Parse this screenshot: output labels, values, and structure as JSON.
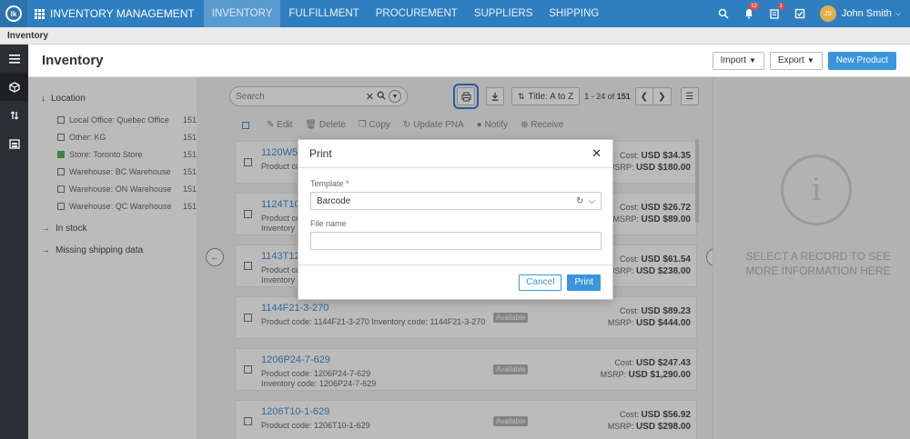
{
  "app": {
    "logo_text": "lk",
    "title": "INVENTORY MANAGEMENT",
    "nav": [
      "INVENTORY",
      "FULFILLMENT",
      "PROCUREMENT",
      "SUPPLIERS",
      "SHIPPING"
    ],
    "notif_count": "12",
    "tasks_count": "1",
    "user_initials": "JS",
    "user_name": "John Smith"
  },
  "breadcrumb": "Inventory",
  "header": {
    "title": "Inventory",
    "import_label": "Import",
    "export_label": "Export",
    "new_label": "New Product"
  },
  "filters": {
    "location_label": "Location",
    "items": [
      {
        "name": "Local Office: Quebec Office",
        "count": "151",
        "checked": false
      },
      {
        "name": "Other: KG",
        "count": "151",
        "checked": false
      },
      {
        "name": "Store: Toronto Store",
        "count": "151",
        "checked": true
      },
      {
        "name": "Warehouse: BC Warehouse",
        "count": "151",
        "checked": false
      },
      {
        "name": "Warehouse: ON Warehouse",
        "count": "151",
        "checked": false
      },
      {
        "name": "Warehouse: QC Warehouse",
        "count": "151",
        "checked": false
      }
    ],
    "in_stock": "In stock",
    "missing": "Missing shipping data"
  },
  "toolbar": {
    "search_placeholder": "Search",
    "sort_label": "Title: A to Z",
    "pager_range": "1 - 24",
    "pager_of": "of",
    "pager_total": "151"
  },
  "actions": [
    "Edit",
    "Delete",
    "Copy",
    "Update PNA",
    "Notify",
    "Receive"
  ],
  "rows": [
    {
      "title": "1120W5-6",
      "sub": "Product code",
      "sub2": "",
      "cost_label": "Cost:",
      "cost": "USD $34.35",
      "msrp_label": "MSRP:",
      "msrp": "USD $180.00",
      "avail": ""
    },
    {
      "title": "1124T10-",
      "sub": "Product co",
      "sub2": "Inventory c",
      "cost_label": "Cost:",
      "cost": "USD $26.72",
      "msrp_label": "MSRP:",
      "msrp": "USD $89.00",
      "avail": ""
    },
    {
      "title": "1143T12-",
      "sub": "Product co",
      "sub2": "Inventory c",
      "cost_label": "Cost:",
      "cost": "USD $61.54",
      "msrp_label": "MSRP:",
      "msrp": "USD $238.00",
      "avail": ""
    },
    {
      "title": "1144F21-3-270",
      "sub": "Product code: 1144F21-3-270   Inventory code: 1144F21-3-270",
      "sub2": "",
      "cost_label": "Cost:",
      "cost": "USD $89.23",
      "msrp_label": "MSRP:",
      "msrp": "USD $444.00",
      "avail": "Available"
    },
    {
      "title": "1206P24-7-629",
      "sub": "Product code: 1206P24-7-629",
      "sub2": "Inventory code: 1206P24-7-629",
      "cost_label": "Cost:",
      "cost": "USD $247.43",
      "msrp_label": "MSRP:",
      "msrp": "USD $1,290.00",
      "avail": "Available"
    },
    {
      "title": "1206T10-1-629",
      "sub": "Product code: 1206T10-1-629",
      "sub2": "",
      "cost_label": "Cost:",
      "cost": "USD $56.92",
      "msrp_label": "MSRP:",
      "msrp": "USD $298.00",
      "avail": "Available"
    }
  ],
  "detail": {
    "message": "SELECT A RECORD TO SEE MORE INFORMATION HERE"
  },
  "modal": {
    "title": "Print",
    "template_label": "Template",
    "template_required": "*",
    "template_value": "Barcode",
    "filename_label": "File name",
    "filename_value": "",
    "cancel_label": "Cancel",
    "print_label": "Print"
  }
}
